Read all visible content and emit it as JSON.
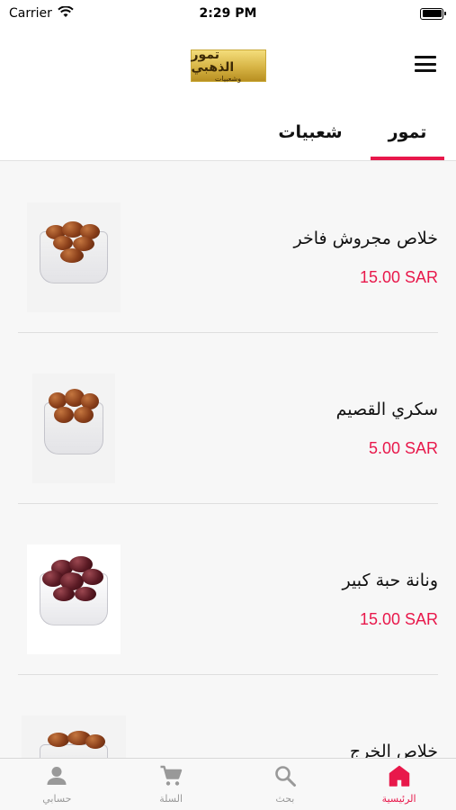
{
  "status_bar": {
    "carrier": "Carrier",
    "time": "2:29 PM"
  },
  "header": {
    "logo_main": "تمور الذهبي",
    "logo_sub": "وشعبيات"
  },
  "tabs": [
    {
      "label": "تمور",
      "active": true
    },
    {
      "label": "شعبيات",
      "active": false
    }
  ],
  "products": [
    {
      "name": "خلاص مجروش فاخر",
      "price": "15.00 SAR",
      "image": "dates-bowl"
    },
    {
      "name": "سكري القصيم",
      "price": "5.00 SAR",
      "image": "dates-bowl"
    },
    {
      "name": "ونانة حبة كبير",
      "price": "15.00 SAR",
      "image": "dark-dates-bowl"
    },
    {
      "name": "خلاص الخرج",
      "price": "",
      "image": "dates-bowl"
    }
  ],
  "tabbar": [
    {
      "label": "حسابي",
      "icon": "person-icon",
      "active": false
    },
    {
      "label": "السلة",
      "icon": "cart-icon",
      "active": false
    },
    {
      "label": "بحث",
      "icon": "search-icon",
      "active": false
    },
    {
      "label": "الرئيسية",
      "icon": "home-icon",
      "active": true
    }
  ],
  "colors": {
    "accent": "#e8184b",
    "inactive": "#999999"
  }
}
